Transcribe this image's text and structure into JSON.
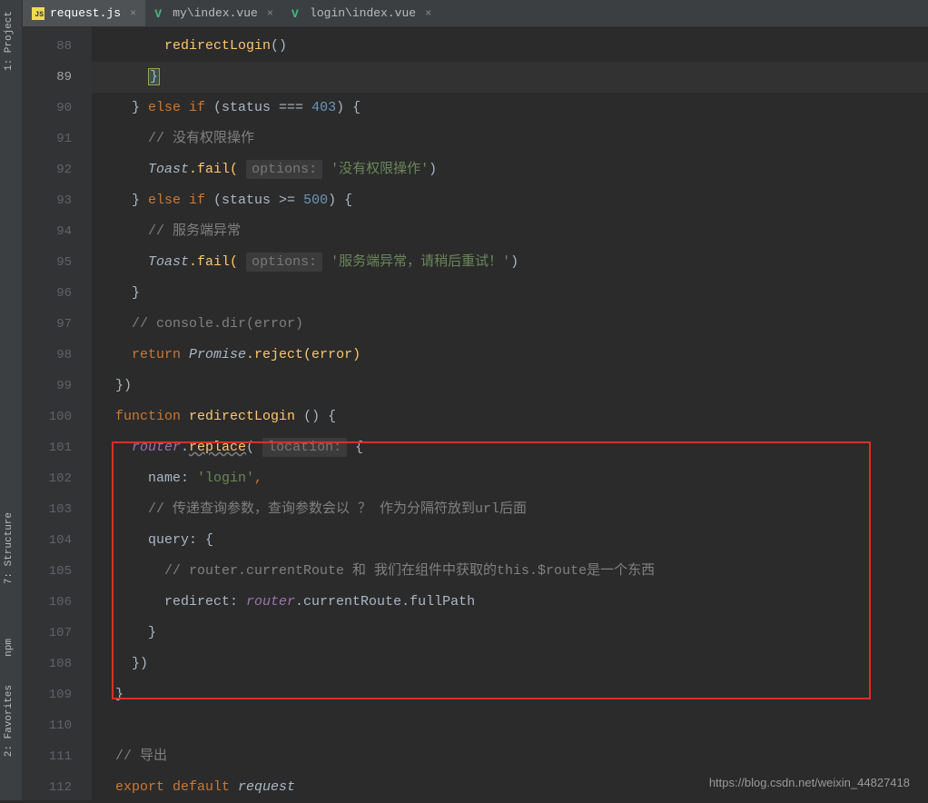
{
  "sidebar": {
    "tabs": [
      {
        "label": "1: Project"
      },
      {
        "label": "7: Structure"
      },
      {
        "label": "npm"
      },
      {
        "label": "2: Favorites"
      }
    ]
  },
  "tabs": [
    {
      "label": "request.js",
      "type": "js",
      "active": true
    },
    {
      "label": "my\\index.vue",
      "type": "vue",
      "active": false
    },
    {
      "label": "login\\index.vue",
      "type": "vue",
      "active": false
    }
  ],
  "gutter": {
    "start": 88,
    "end": 112,
    "highlighted": 89
  },
  "code": {
    "l88": {
      "fn": "redirectLogin",
      "rest": "()"
    },
    "l89": {
      "brace": "}"
    },
    "l90": {
      "p1": "} ",
      "kw": "else if ",
      "p2": "(status === ",
      "num": "403",
      "p3": ") {"
    },
    "l91": {
      "cm": "// 没有权限操作"
    },
    "l92": {
      "obj": "Toast",
      "m": ".fail(",
      "hint": "options:",
      "str": "'没有权限操作'",
      "end": ")"
    },
    "l93": {
      "p1": "} ",
      "kw": "else if ",
      "p2": "(status >= ",
      "num": "500",
      "p3": ") {"
    },
    "l94": {
      "cm": "// 服务端异常"
    },
    "l95": {
      "obj": "Toast",
      "m": ".fail(",
      "hint": "options:",
      "str": "'服务端异常，请稍后重试！'",
      "end": ")"
    },
    "l96": {
      "brace": "}"
    },
    "l97": {
      "cm": "// console.dir(error)"
    },
    "l98": {
      "kw": "return ",
      "obj": "Promise",
      "m": ".reject(error)"
    },
    "l99": {
      "text": "})"
    },
    "l100": {
      "kw": "function ",
      "fn": "redirectLogin ",
      "rest": "() {"
    },
    "l101": {
      "obj": "router",
      "m1": ".",
      "m2": "replace",
      "m3": "(",
      "hint": "location:",
      "rest": " {"
    },
    "l102": {
      "prop": "name: ",
      "str": "'login'",
      "rest": ","
    },
    "l103": {
      "cm": "// 传递查询参数，查询参数会以 ？ 作为分隔符放到url后面"
    },
    "l104": {
      "prop": "query: ",
      "rest": "{"
    },
    "l105": {
      "cm": "// router.currentRoute 和 我们在组件中获取的this.$route是一个东西"
    },
    "l106": {
      "prop": "redirect: ",
      "obj": "router",
      "rest": ".currentRoute.fullPath"
    },
    "l107": {
      "brace": "}"
    },
    "l108": {
      "text": "})"
    },
    "l109": {
      "brace": "}"
    },
    "l110": {
      "text": ""
    },
    "l111": {
      "cm": "// 导出"
    },
    "l112": {
      "kw": "export default ",
      "obj": "request"
    }
  },
  "watermark": "https://blog.csdn.net/weixin_44827418"
}
